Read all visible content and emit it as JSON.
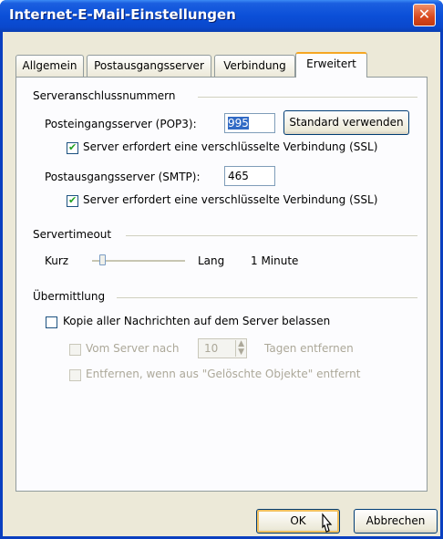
{
  "window": {
    "title": "Internet-E-Mail-Einstellungen",
    "close_glyph": "✕"
  },
  "tabs": [
    {
      "label": "Allgemein"
    },
    {
      "label": "Postausgangsserver"
    },
    {
      "label": "Verbindung"
    },
    {
      "label": "Erweitert",
      "active": true
    }
  ],
  "serverports": {
    "group_label": "Serveranschlussnummern",
    "pop3_label": "Posteingangsserver (POP3):",
    "pop3_value": "995",
    "default_button": "Standard verwenden",
    "pop3_ssl_label": "Server erfordert eine verschlüsselte Verbindung (SSL)",
    "pop3_ssl_checked": true,
    "smtp_label": "Postausgangsserver (SMTP):",
    "smtp_value": "465",
    "smtp_ssl_label": "Server erfordert eine verschlüsselte Verbindung (SSL)",
    "smtp_ssl_checked": true
  },
  "timeout": {
    "group_label": "Servertimeout",
    "short_label": "Kurz",
    "long_label": "Lang",
    "value_label": "1 Minute",
    "level": 0.1
  },
  "delivery": {
    "group_label": "Übermittlung",
    "keep_copy_label": "Kopie aller Nachrichten auf dem Server belassen",
    "keep_copy_checked": false,
    "remove_after_label": "Vom Server nach",
    "remove_after_days": "10",
    "days_label": "Tagen entfernen",
    "remove_deleted_label": "Entfernen, wenn aus \"Gelöschte Objekte\" entfernt"
  },
  "buttons": {
    "ok": "OK",
    "cancel": "Abbrechen"
  },
  "colors": {
    "titlebar": "#0b4fd8",
    "dialog": "#ece9d8",
    "tab_highlight": "#f5a623",
    "check": "#21a121"
  }
}
